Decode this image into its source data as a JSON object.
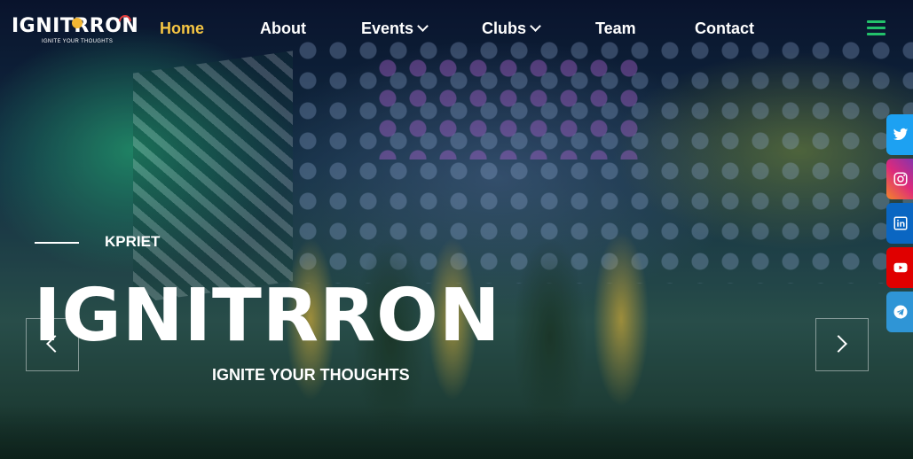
{
  "logo": {
    "name": "IGNITRRON",
    "tagline": "IGNITE YOUR THOUGHTS"
  },
  "nav": {
    "items": [
      {
        "label": "Home",
        "active": true,
        "dropdown": false
      },
      {
        "label": "About",
        "active": false,
        "dropdown": false
      },
      {
        "label": "Events",
        "active": false,
        "dropdown": true
      },
      {
        "label": "Clubs",
        "active": false,
        "dropdown": true
      },
      {
        "label": "Team",
        "active": false,
        "dropdown": false
      },
      {
        "label": "Contact",
        "active": false,
        "dropdown": false
      }
    ],
    "menu_icon": "hamburger-icon"
  },
  "hero": {
    "eyebrow": "KPRIET",
    "title": "IGNITRRON",
    "tagline": "IGNITE YOUR THOUGHTS",
    "prev_icon": "chevron-left-icon",
    "next_icon": "chevron-right-icon"
  },
  "social": [
    {
      "name": "twitter-icon",
      "color": "#1da1f2"
    },
    {
      "name": "instagram-icon",
      "color": "#e1306c"
    },
    {
      "name": "linkedin-icon",
      "color": "#0a66c2"
    },
    {
      "name": "youtube-icon",
      "color": "#e00000"
    },
    {
      "name": "telegram-icon",
      "color": "#2f95d6"
    }
  ],
  "colors": {
    "accent": "#f6c643",
    "menu": "#23c16b"
  }
}
